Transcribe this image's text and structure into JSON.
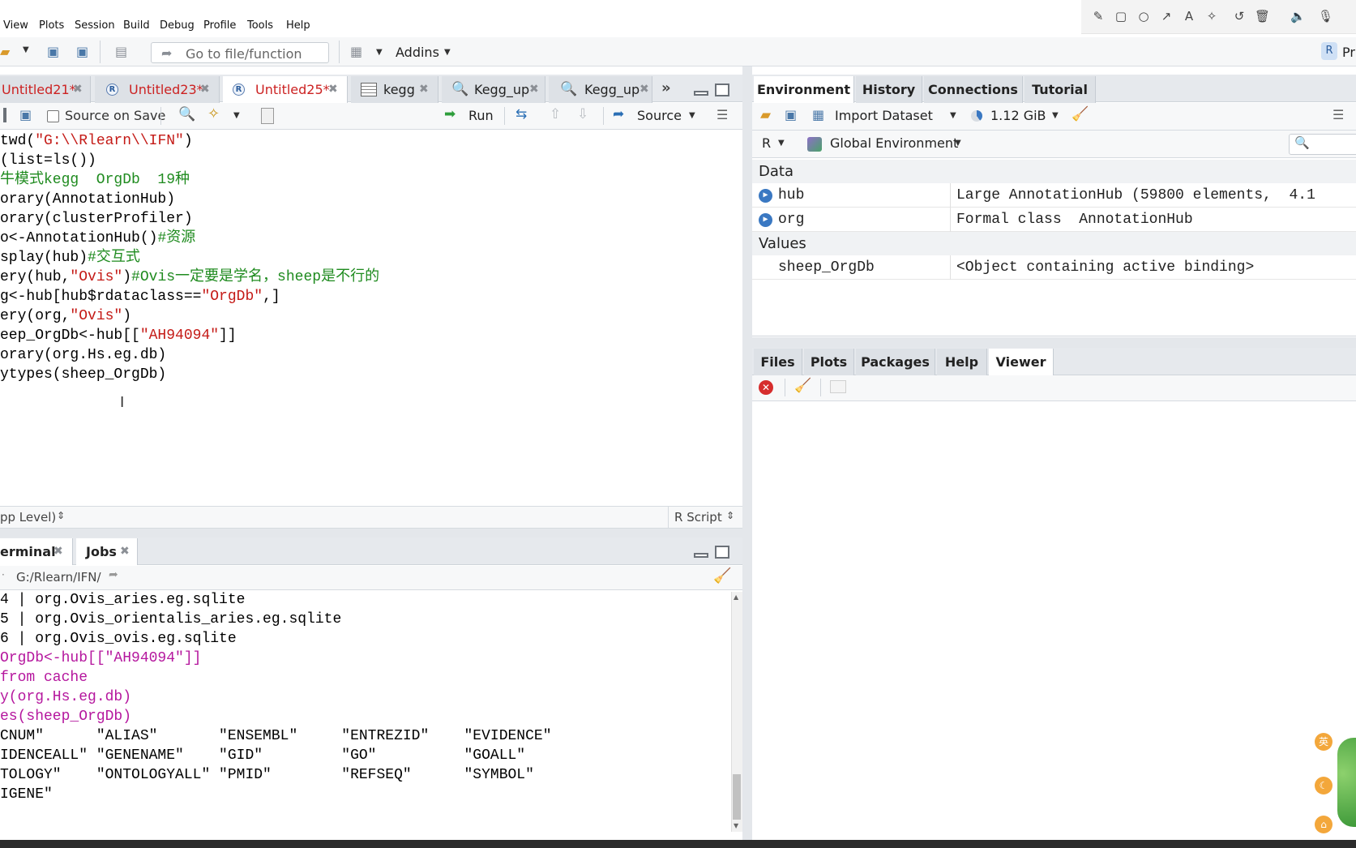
{
  "menu": [
    "View",
    "Plots",
    "Session",
    "Build",
    "Debug",
    "Profile",
    "Tools",
    "Help"
  ],
  "toolbar": {
    "goto_placeholder": "Go to file/function",
    "addins_label": "Addins",
    "project_label": "Pr"
  },
  "editor": {
    "tabs": [
      {
        "label": "Untitled21*",
        "icon": "none"
      },
      {
        "label": "Untitled23*",
        "icon": "r-file-icon"
      },
      {
        "label": "Untitled25*",
        "icon": "r-file-icon",
        "active": true
      },
      {
        "label": "kegg",
        "icon": "table-icon"
      },
      {
        "label": "Kegg_up",
        "icon": "search-icon"
      },
      {
        "label": "Kegg_up",
        "icon": "search-icon"
      }
    ],
    "source_on_save": "Source on Save",
    "run_label": "Run",
    "source_label": "Source",
    "status_scope": "pp Level)",
    "status_type": "R Script",
    "code_lines": [
      [
        {
          "t": "twd(",
          "c": "fn"
        },
        {
          "t": "\"G:\\\\Rlearn\\\\IFN\"",
          "c": "str"
        },
        {
          "t": ")",
          "c": "op"
        }
      ],
      [
        {
          "t": "(list=ls())",
          "c": "fn"
        }
      ],
      [
        {
          "t": "牛模式kegg  OrgDb  19种",
          "c": "cmt"
        }
      ],
      [
        {
          "t": "orary(AnnotationHub)",
          "c": "fn"
        }
      ],
      [
        {
          "t": "orary(clusterProfiler)",
          "c": "fn"
        }
      ],
      [
        {
          "t": "o<-AnnotationHub()",
          "c": "fn"
        },
        {
          "t": "#资源",
          "c": "cmt"
        }
      ],
      [
        {
          "t": "splay(hub)",
          "c": "fn"
        },
        {
          "t": "#交互式",
          "c": "cmt"
        }
      ],
      [
        {
          "t": "ery(hub,",
          "c": "fn"
        },
        {
          "t": "\"Ovis\"",
          "c": "str"
        },
        {
          "t": ")",
          "c": "fn"
        },
        {
          "t": "#Ovis一定要是学名，sheep是不行的",
          "c": "cmt"
        }
      ],
      [
        {
          "t": "g<-hub[hub$rdataclass==",
          "c": "fn"
        },
        {
          "t": "\"OrgDb\"",
          "c": "str"
        },
        {
          "t": ",]",
          "c": "fn"
        }
      ],
      [
        {
          "t": "ery(org,",
          "c": "fn"
        },
        {
          "t": "\"Ovis\"",
          "c": "str"
        },
        {
          "t": ")",
          "c": "fn"
        }
      ],
      [
        {
          "t": "eep_OrgDb<-hub[[",
          "c": "fn"
        },
        {
          "t": "\"AH94094\"",
          "c": "str"
        },
        {
          "t": "]]",
          "c": "fn"
        }
      ],
      [
        {
          "t": "orary(org.Hs.eg.db)",
          "c": "fn"
        }
      ],
      [
        {
          "t": "ytypes(sheep_OrgDb)",
          "c": "fn"
        }
      ]
    ]
  },
  "console": {
    "tabs": [
      "erminal",
      "Jobs"
    ],
    "path": "G:/Rlearn/IFN/",
    "lines": [
      {
        "t": "4 | org.Ovis_aries.eg.sqlite",
        "c": "out"
      },
      {
        "t": "5 | org.Ovis_orientalis_aries.eg.sqlite",
        "c": "out"
      },
      {
        "t": "6 | org.Ovis_ovis.eg.sqlite",
        "c": "out"
      },
      {
        "t": "OrgDb<-hub[[\"AH94094\"]]",
        "c": "cmd"
      },
      {
        "t": "from cache",
        "c": "cmd"
      },
      {
        "t": "y(org.Hs.eg.db)",
        "c": "cmd"
      },
      {
        "t": "es(sheep_OrgDb)",
        "c": "cmd"
      },
      {
        "t": "CNUM\"      \"ALIAS\"       \"ENSEMBL\"     \"ENTREZID\"    \"EVIDENCE\"",
        "c": "out"
      },
      {
        "t": "IDENCEALL\" \"GENENAME\"    \"GID\"         \"GO\"          \"GOALL\"",
        "c": "out"
      },
      {
        "t": "TOLOGY\"    \"ONTOLOGYALL\" \"PMID\"        \"REFSEQ\"      \"SYMBOL\"",
        "c": "out"
      },
      {
        "t": "IGENE\"",
        "c": "out"
      }
    ]
  },
  "environment": {
    "tabs": [
      "Environment",
      "History",
      "Connections",
      "Tutorial"
    ],
    "import_label": "Import Dataset",
    "memory": "1.12 GiB",
    "lang": "R",
    "scope": "Global Environment",
    "data_header": "Data",
    "values_header": "Values",
    "data_rows": [
      {
        "name": "hub",
        "value": "Large AnnotationHub (59800 elements,  4.1"
      },
      {
        "name": "org",
        "value": "Formal class  AnnotationHub"
      }
    ],
    "value_rows": [
      {
        "name": "sheep_OrgDb",
        "value": "<Object containing active binding>"
      }
    ]
  },
  "viewer": {
    "tabs": [
      "Files",
      "Plots",
      "Packages",
      "Help",
      "Viewer"
    ]
  },
  "side_badges": [
    "英"
  ]
}
